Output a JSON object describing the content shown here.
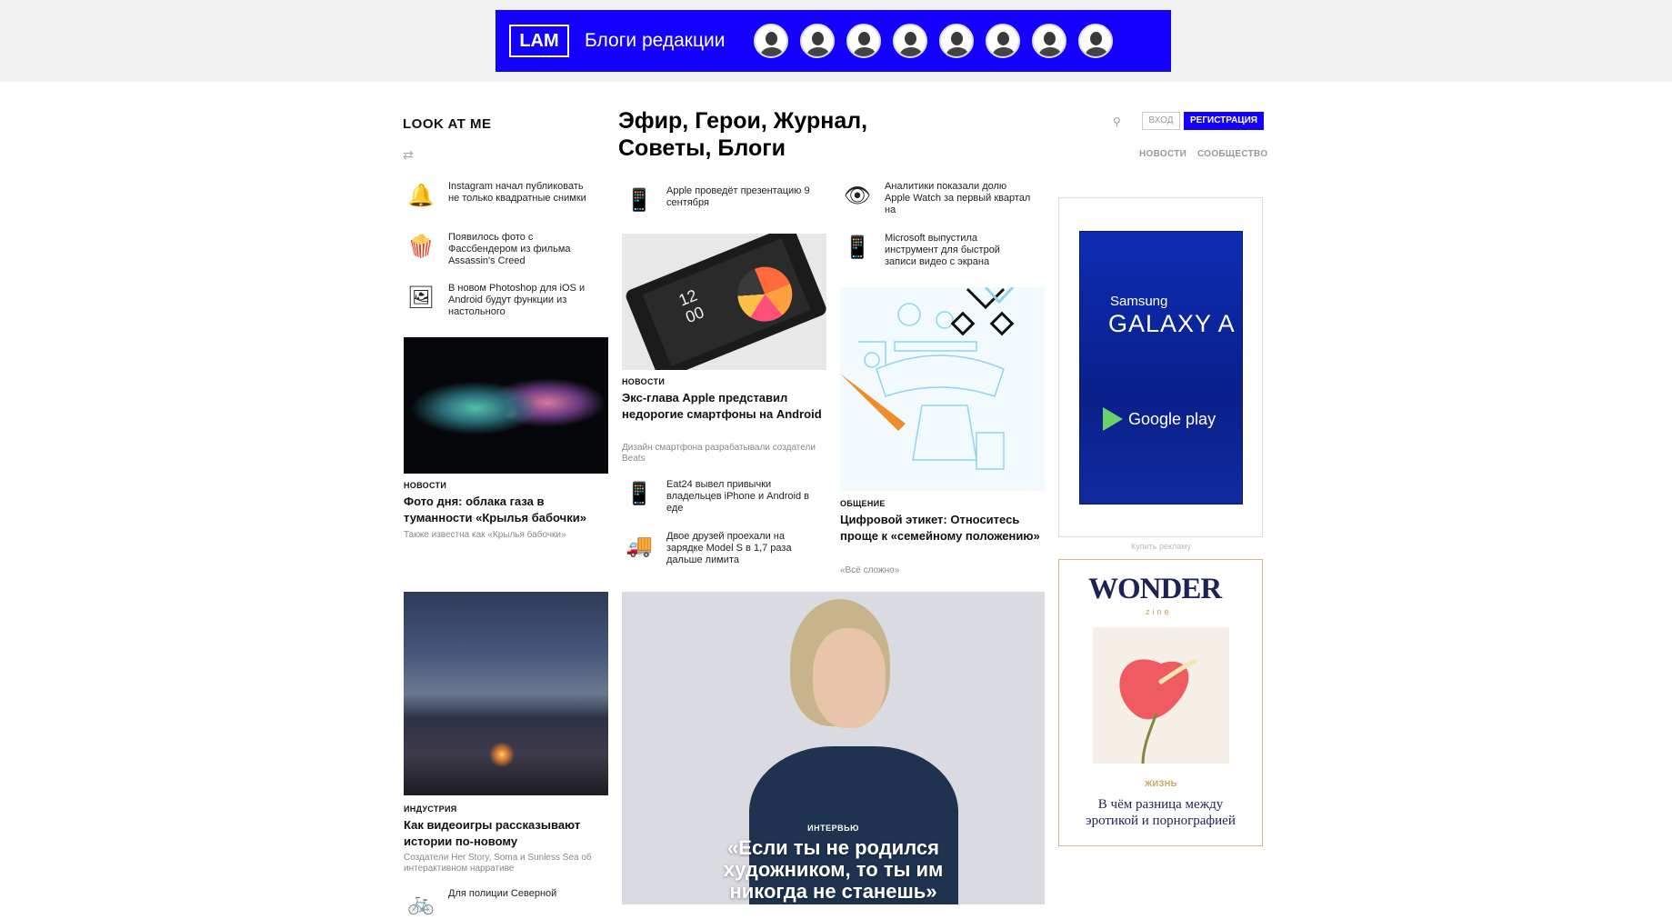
{
  "banner": {
    "logo": "LAM",
    "title": "Блоги редакции"
  },
  "header": {
    "logo": "LOOK AT ME",
    "sections": "Эфир,  Герои,  Журнал,  Советы,  Блоги",
    "login": "ВХОД",
    "register": "РЕГИСТРАЦИЯ",
    "subnav_news": "НОВОСТИ",
    "subnav_community": "СООБЩЕСТВО"
  },
  "left_news": [
    {
      "icon": "🔔",
      "text": "Instagram начал публиковать не только квадратные снимки"
    },
    {
      "icon": "🍿",
      "text": "Появилось фото с Фассбендером из фильма Assassin's Creed"
    },
    {
      "icon": "🖼",
      "text": "В новом Photoshop для iOS и Android будут функции из настольного"
    }
  ],
  "mid_news_top": {
    "icon": "📱",
    "text": "Apple проведёт презентацию 9 сентября"
  },
  "right_news": [
    {
      "icon": "👁",
      "text": "Аналитики показали долю Apple Watch за первый квартал на"
    },
    {
      "icon": "📱",
      "text": "Microsoft выпустила инструмент для быстрой записи видео с экрана"
    }
  ],
  "mid_news_bottom": [
    {
      "icon": "📱",
      "text": "Eat24 вывел привычки владельцев iPhone и Android в еде"
    },
    {
      "icon": "🚚",
      "text": "Двое друзей проехали на зарядке Model S в 1,7 раза дальше лимита"
    }
  ],
  "cards": {
    "nebula": {
      "tag": "НОВОСТИ",
      "title": "Фото дня: облака газа в туманности «Крылья бабочки»",
      "sub": "Также известна как «Крылья бабочки»"
    },
    "phone": {
      "tag": "НОВОСТИ",
      "title": "Экс-глава Apple представил недорогие смартфоны на Android",
      "sub": "Дизайн смартфона разрабатывали создатели Beats",
      "screen_time": "12",
      "screen_minutes": "00"
    },
    "etiquette": {
      "tag": "ОБЩЕНИЕ",
      "title": "Цифровой этикет: Относитесь проще к «семейному положению»",
      "sub": "«Всё сложно»"
    },
    "games": {
      "tag": "ИНДУСТРИЯ",
      "title": "Как видеоигры рассказывают истории по-новому",
      "sub": "Создатели Her Story, Soma и Sunless Sea об интерактивном нарративе"
    },
    "police": {
      "icon": "🚲",
      "text": "Для полиции Северной"
    },
    "interview": {
      "tag": "ИНТЕРВЬЮ",
      "title": "«Если ты не родился художником, то ты им никогда не станешь»"
    }
  },
  "ads": {
    "samsung": "Samsung",
    "galaxy": "GALAXY A",
    "google_play": "Google play",
    "buy_ad": "Купить рекламу"
  },
  "wonder": {
    "logo": "WONDER",
    "sub": "zine",
    "tag": "ЖИЗНЬ",
    "title": "В чём разница между эротикой и порнографией"
  },
  "colors": {
    "brand_blue": "#1400ff",
    "wonder_navy": "#1e2356",
    "wonder_gold": "#d6b989"
  }
}
